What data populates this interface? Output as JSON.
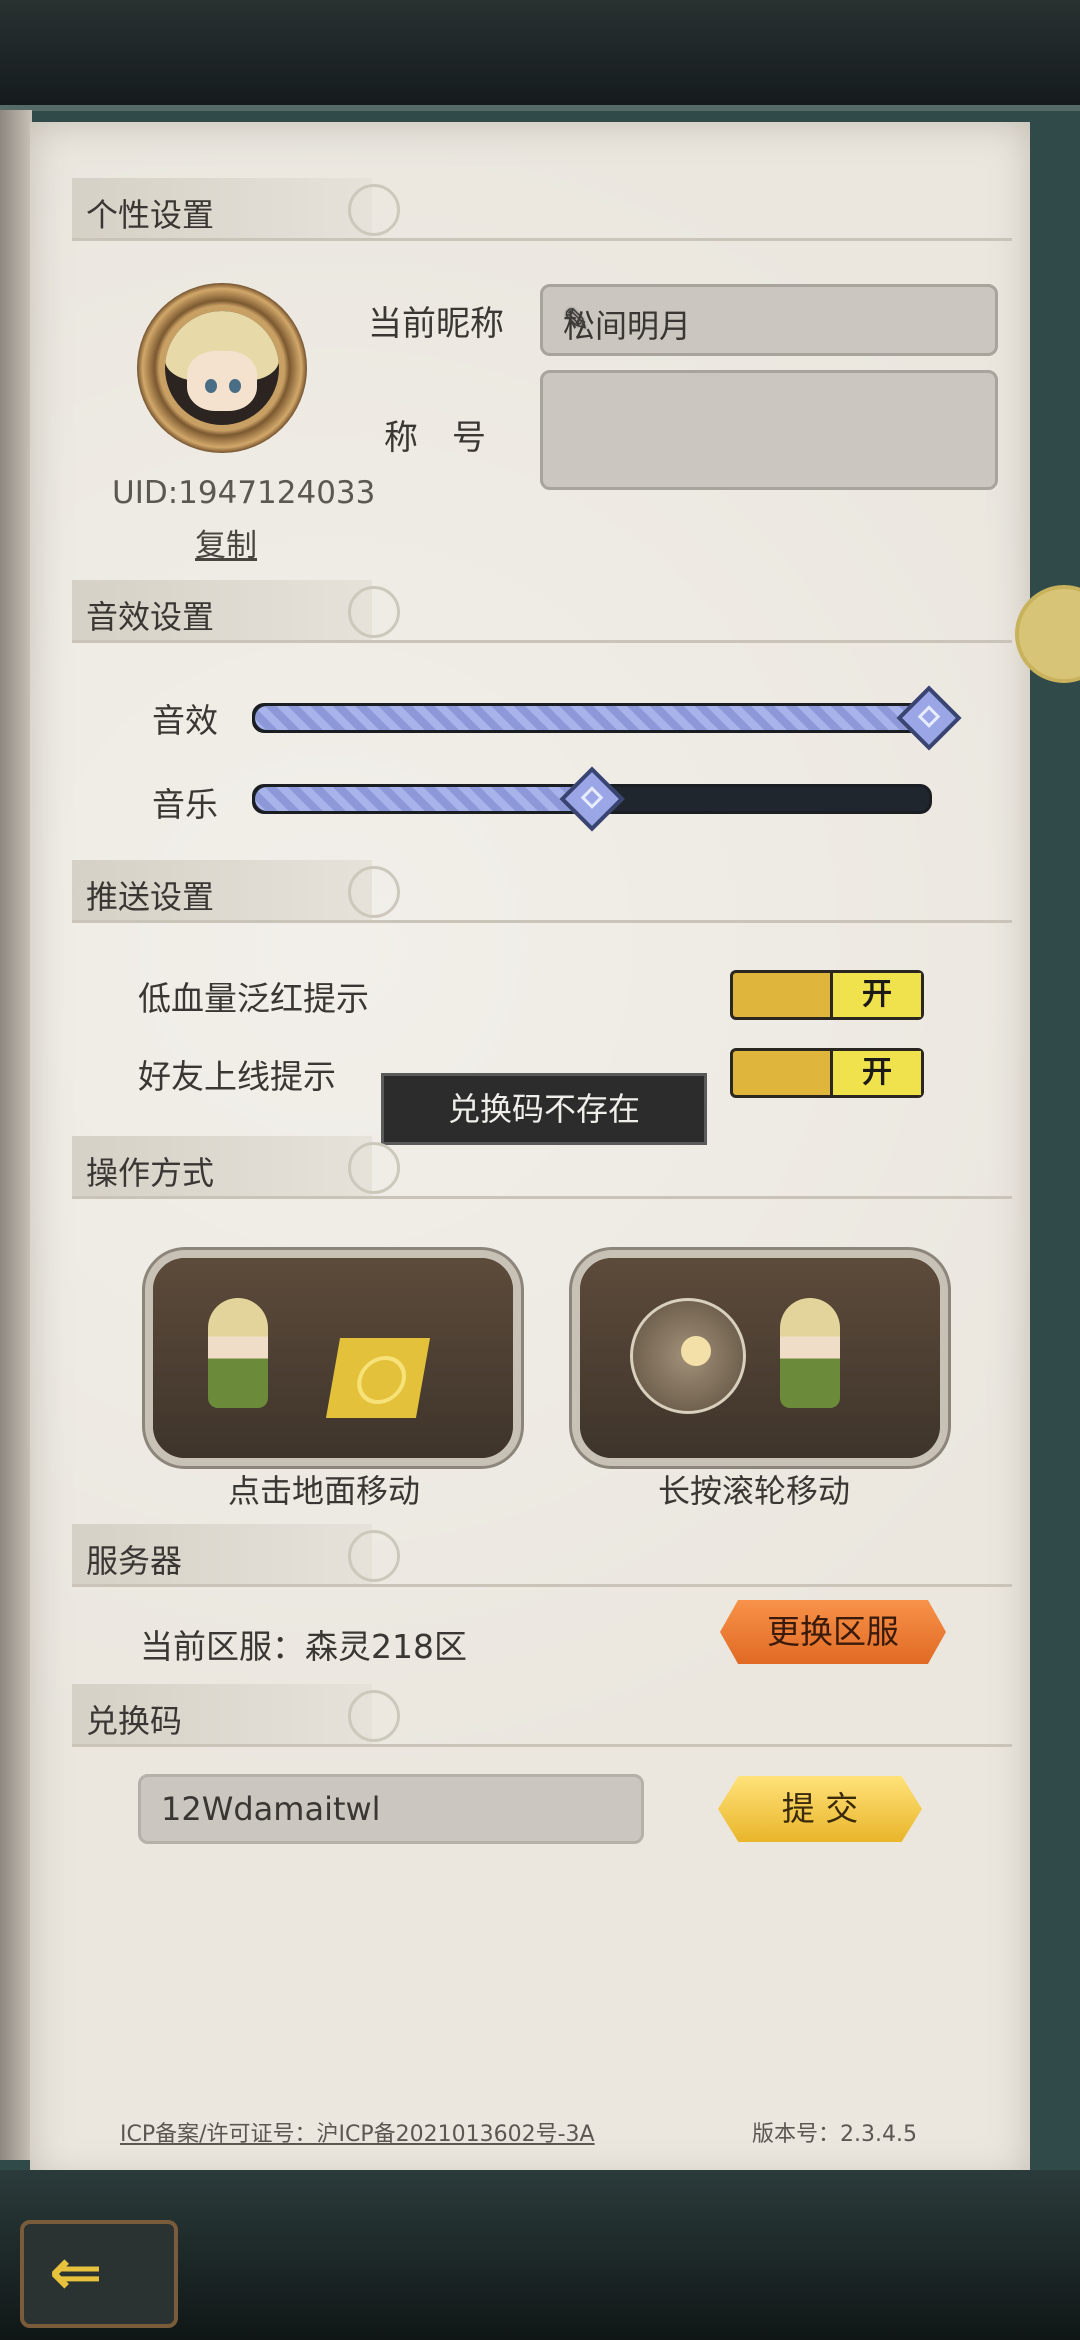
{
  "sections": {
    "personal": "个性设置",
    "sound": "音效设置",
    "push": "推送设置",
    "control": "操作方式",
    "server": "服务器",
    "redeem": "兑换码"
  },
  "profile": {
    "uid": "UID:1947124033",
    "copy": "复制",
    "nickname_label": "当前昵称",
    "nickname": "松间明月",
    "title_label": "称　号",
    "title_value": ""
  },
  "sound": {
    "effect_label": "音效",
    "music_label": "音乐",
    "effect_level": 1.0,
    "music_level": 0.5
  },
  "push": {
    "items": [
      {
        "label": "低血量泛红提示",
        "state": "开"
      },
      {
        "label": "好友上线提示",
        "state": "开"
      }
    ]
  },
  "toast": "兑换码不存在",
  "control": {
    "options": [
      {
        "caption": "点击地面移动"
      },
      {
        "caption": "长按滚轮移动"
      }
    ]
  },
  "server": {
    "current": "当前区服：森灵218区",
    "change_button": "更换区服"
  },
  "redeem": {
    "code": "12Wdamaitwl",
    "submit": "提 交"
  },
  "footer": {
    "icp": "ICP备案/许可证号：沪ICP备2021013602号-3A",
    "version": "版本号：2.3.4.5"
  },
  "icons": [
    "feather-icon",
    "back-arrow-icon",
    "clip-icon"
  ]
}
